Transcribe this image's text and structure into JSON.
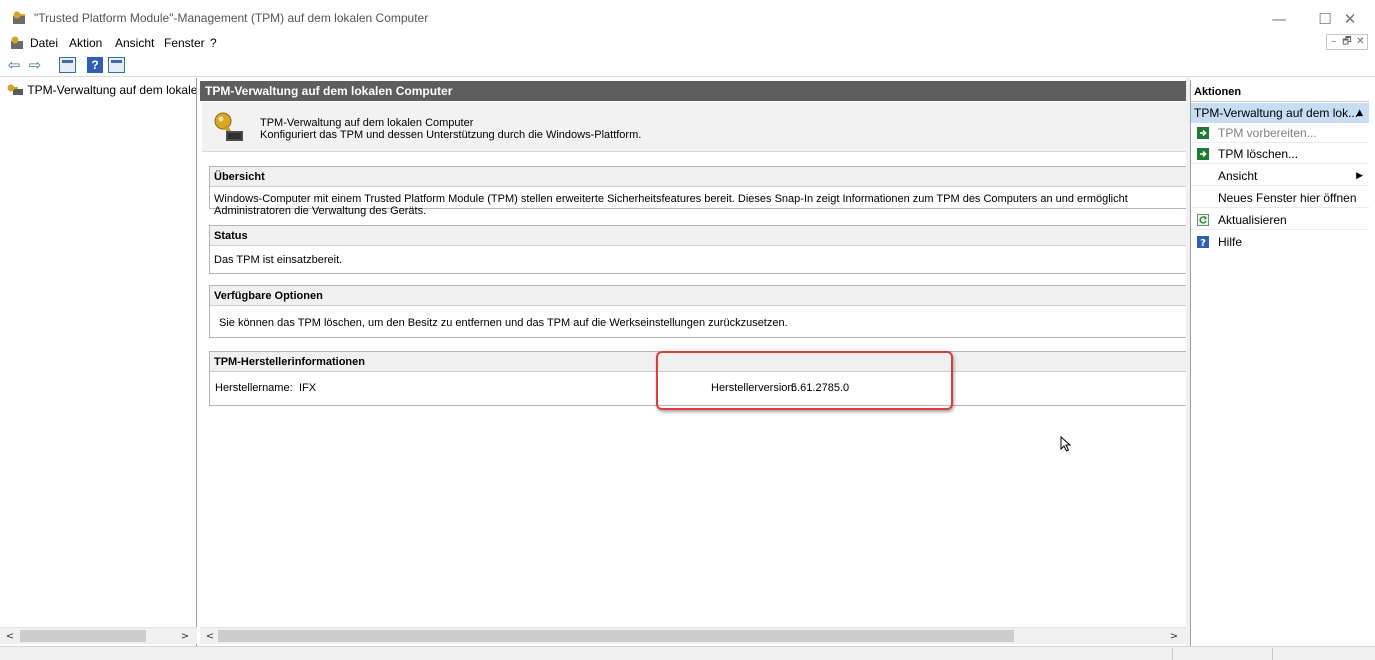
{
  "window": {
    "title": "\"Trusted Platform Module\"-Management (TPM) auf dem lokalen Computer",
    "minimize_glyph": "—",
    "maximize_glyph": "☐",
    "close_glyph": "✕"
  },
  "menu": {
    "items": [
      "Datei",
      "Aktion",
      "Ansicht",
      "Fenster",
      "?"
    ],
    "mdi_buttons": [
      "–",
      "🗗",
      "✕"
    ]
  },
  "toolbar": {
    "back_glyph": "⇦",
    "forward_glyph": "⇨",
    "help_glyph": "?"
  },
  "tree": {
    "root_label": "TPM-Verwaltung auf dem lokalen Computer"
  },
  "scroll": {
    "left_glyph": "<",
    "right_glyph": ">"
  },
  "center": {
    "header": "TPM-Verwaltung auf dem lokalen Computer",
    "intro_line1": "TPM-Verwaltung auf dem lokalen Computer",
    "intro_line2": "Konfiguriert das TPM und dessen Unterstützung durch die Windows-Plattform.",
    "sections": {
      "overview": {
        "title": "Übersicht",
        "text": "Windows-Computer mit einem Trusted Platform Module (TPM) stellen erweiterte Sicherheitsfeatures bereit. Dieses Snap-In zeigt Informationen zum TPM des Computers an und ermöglicht Administratoren die Verwaltung des Geräts."
      },
      "status": {
        "title": "Status",
        "text": "Das TPM ist einsatzbereit."
      },
      "options": {
        "title": "Verfügbare Optionen",
        "text": "Sie können das TPM löschen, um den Besitz zu entfernen und das TPM auf die Werkseinstellungen zurückzusetzen."
      },
      "manufacturer": {
        "title": "TPM-Herstellerinformationen",
        "name_label": "Herstellername:",
        "name_value": "IFX",
        "version_label": "Herstellerversion:",
        "version_value": "5.61.2785.0"
      }
    }
  },
  "actions": {
    "header": "Aktionen",
    "group_label": "TPM-Verwaltung auf dem lok...",
    "group_caret": "▲",
    "submenu_arrow": "▶",
    "items": [
      {
        "label": "TPM vorbereiten...",
        "icon": "green-run-icon",
        "enabled": false
      },
      {
        "label": "TPM löschen...",
        "icon": "green-run-icon",
        "enabled": true
      },
      {
        "label": "Ansicht",
        "icon": "",
        "enabled": true,
        "submenu": true
      },
      {
        "label": "Neues Fenster hier öffnen",
        "icon": "",
        "enabled": true
      },
      {
        "label": "Aktualisieren",
        "icon": "refresh-icon",
        "enabled": true
      },
      {
        "label": "Hilfe",
        "icon": "help-icon",
        "enabled": true
      }
    ]
  },
  "colors": {
    "header_bg": "#5e5e5e",
    "selection_bg": "#c6ddf3",
    "highlight_border": "#e03b3b",
    "action_green": "#1e7b34"
  }
}
